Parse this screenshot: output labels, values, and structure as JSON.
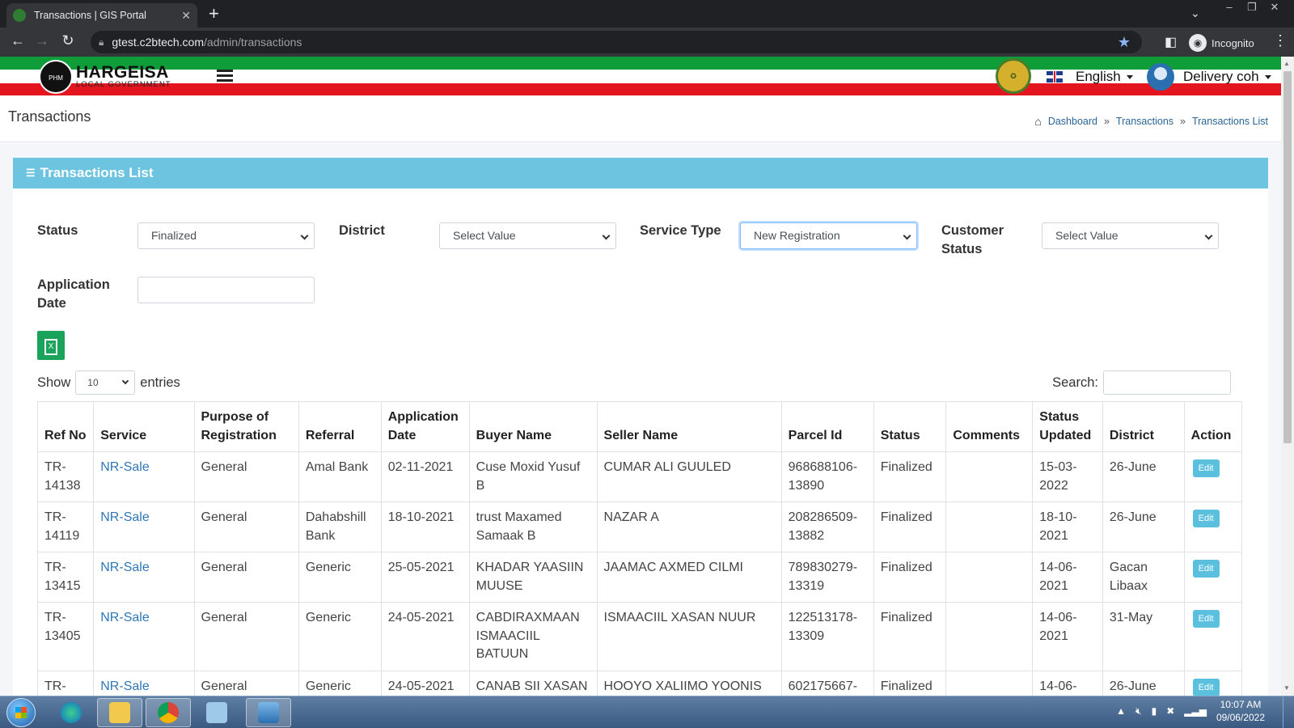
{
  "browser": {
    "tab_title": "Transactions | GIS Portal",
    "url_host": "gtest.c2btech.com",
    "url_path": "/admin/transactions",
    "profile": "Incognito"
  },
  "header": {
    "logo_title": "HARGEISA",
    "logo_subtitle": "LOCAL GOVERNMENT",
    "logo_emblem_text": "PHM",
    "language": "English",
    "user_name": "Delivery coh"
  },
  "page": {
    "title": "Transactions",
    "breadcrumbs": [
      "Dashboard",
      "Transactions",
      "Transactions List"
    ],
    "breadcrumb_separator": "»"
  },
  "card": {
    "title": "Transactions List"
  },
  "filters": {
    "status_label": "Status",
    "status_value": "Finalized",
    "district_label": "District",
    "district_value": "Select Value",
    "service_type_label": "Service Type",
    "service_type_value": "New Registration",
    "customer_status_label": "Customer Status",
    "customer_status_value": "Select Value",
    "application_date_label": "Application Date",
    "application_date_value": ""
  },
  "table_controls": {
    "show_label": "Show",
    "entries_value": "10",
    "entries_label": "entries",
    "search_label": "Search:"
  },
  "table": {
    "columns": [
      "Ref No",
      "Service",
      "Purpose of Registration",
      "Referral",
      "Application Date",
      "Buyer Name",
      "Seller Name",
      "Parcel Id",
      "Status",
      "Comments",
      "Status Updated",
      "District",
      "Action"
    ],
    "rows": [
      {
        "ref": "TR-14138",
        "service": "NR-Sale",
        "purpose": "General",
        "referral": "Amal Bank",
        "app_date": "02-11-2021",
        "buyer": "Cuse Moxid Yusuf B",
        "seller": "CUMAR ALI GUULED",
        "parcel": "968688106-13890",
        "status": "Finalized",
        "comments": "",
        "updated": "15-03-2022",
        "district": "26-June",
        "action": "Edit"
      },
      {
        "ref": "TR-14119",
        "service": "NR-Sale",
        "purpose": "General",
        "referral": "Dahabshill Bank",
        "app_date": "18-10-2021",
        "buyer": "trust Maxamed Samaak B",
        "seller": "NAZAR A",
        "parcel": "208286509-13882",
        "status": "Finalized",
        "comments": "",
        "updated": "18-10-2021",
        "district": "26-June",
        "action": "Edit"
      },
      {
        "ref": "TR-13415",
        "service": "NR-Sale",
        "purpose": "General",
        "referral": "Generic",
        "app_date": "25-05-2021",
        "buyer": "KHADAR YAASIIN MUUSE",
        "seller": "JAAMAC AXMED CILMI",
        "parcel": "789830279-13319",
        "status": "Finalized",
        "comments": "",
        "updated": "14-06-2021",
        "district": "Gacan Libaax",
        "action": "Edit"
      },
      {
        "ref": "TR-13405",
        "service": "NR-Sale",
        "purpose": "General",
        "referral": "Generic",
        "app_date": "24-05-2021",
        "buyer": "CABDIRAXMAAN ISMAACIIL BATUUN",
        "seller": "ISMAACIIL XASAN NUUR",
        "parcel": "122513178-13309",
        "status": "Finalized",
        "comments": "",
        "updated": "14-06-2021",
        "district": "31-May",
        "action": "Edit"
      },
      {
        "ref": "TR-",
        "service": "NR-Sale",
        "purpose": "General",
        "referral": "Generic",
        "app_date": "24-05-2021",
        "buyer": "CANAB SII XASAN",
        "seller": "HOOYO XALIIMO YOONIS",
        "parcel": "602175667-",
        "status": "Finalized",
        "comments": "",
        "updated": "14-06-",
        "district": "26-June",
        "action": "Edit"
      }
    ]
  },
  "taskbar": {
    "time": "10:07 AM",
    "date": "09/06/2022"
  }
}
